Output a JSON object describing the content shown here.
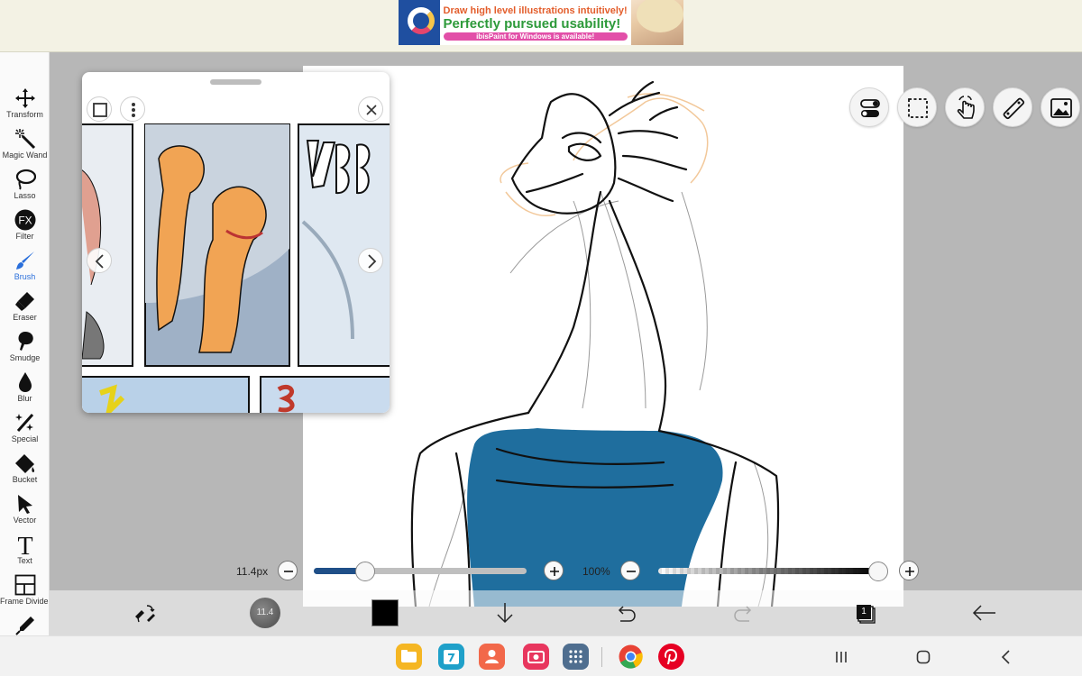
{
  "ad": {
    "line1": "Draw high level illustrations intuitively!",
    "line2": "Perfectly pursued usability!",
    "line3": "ibisPaint for Windows is available!"
  },
  "tools": [
    {
      "label": "Transform",
      "icon": "transform-icon",
      "active": false
    },
    {
      "label": "Magic Wand",
      "icon": "magic-wand-icon",
      "active": false
    },
    {
      "label": "Lasso",
      "icon": "lasso-icon",
      "active": false
    },
    {
      "label": "Filter",
      "icon": "fx-filter-icon",
      "active": false
    },
    {
      "label": "Brush",
      "icon": "brush-icon",
      "active": true
    },
    {
      "label": "Eraser",
      "icon": "eraser-icon",
      "active": false
    },
    {
      "label": "Smudge",
      "icon": "smudge-icon",
      "active": false
    },
    {
      "label": "Blur",
      "icon": "blur-drop-icon",
      "active": false
    },
    {
      "label": "Special",
      "icon": "special-wand-icon",
      "active": false
    },
    {
      "label": "Bucket",
      "icon": "bucket-icon",
      "active": false
    },
    {
      "label": "Vector",
      "icon": "vector-arrow-icon",
      "active": false
    },
    {
      "label": "Text",
      "icon": "text-t-icon",
      "active": false
    },
    {
      "label": "Frame Divider",
      "icon": "frame-divider-icon",
      "active": false
    }
  ],
  "filter_glyph": "FX",
  "text_glyph": "T",
  "sliders": {
    "brush_size_label": "11.4px",
    "brush_size_fraction": 0.24,
    "opacity_label": "100%",
    "opacity_fraction": 1.0
  },
  "bottom": {
    "brush_size_badge": "11.4",
    "current_color": "#000000",
    "layer_count": "1"
  },
  "colors": {
    "accent": "#2a6fdb",
    "slider_fill": "#1f4f88",
    "paint_blue": "#1f6e9e"
  }
}
